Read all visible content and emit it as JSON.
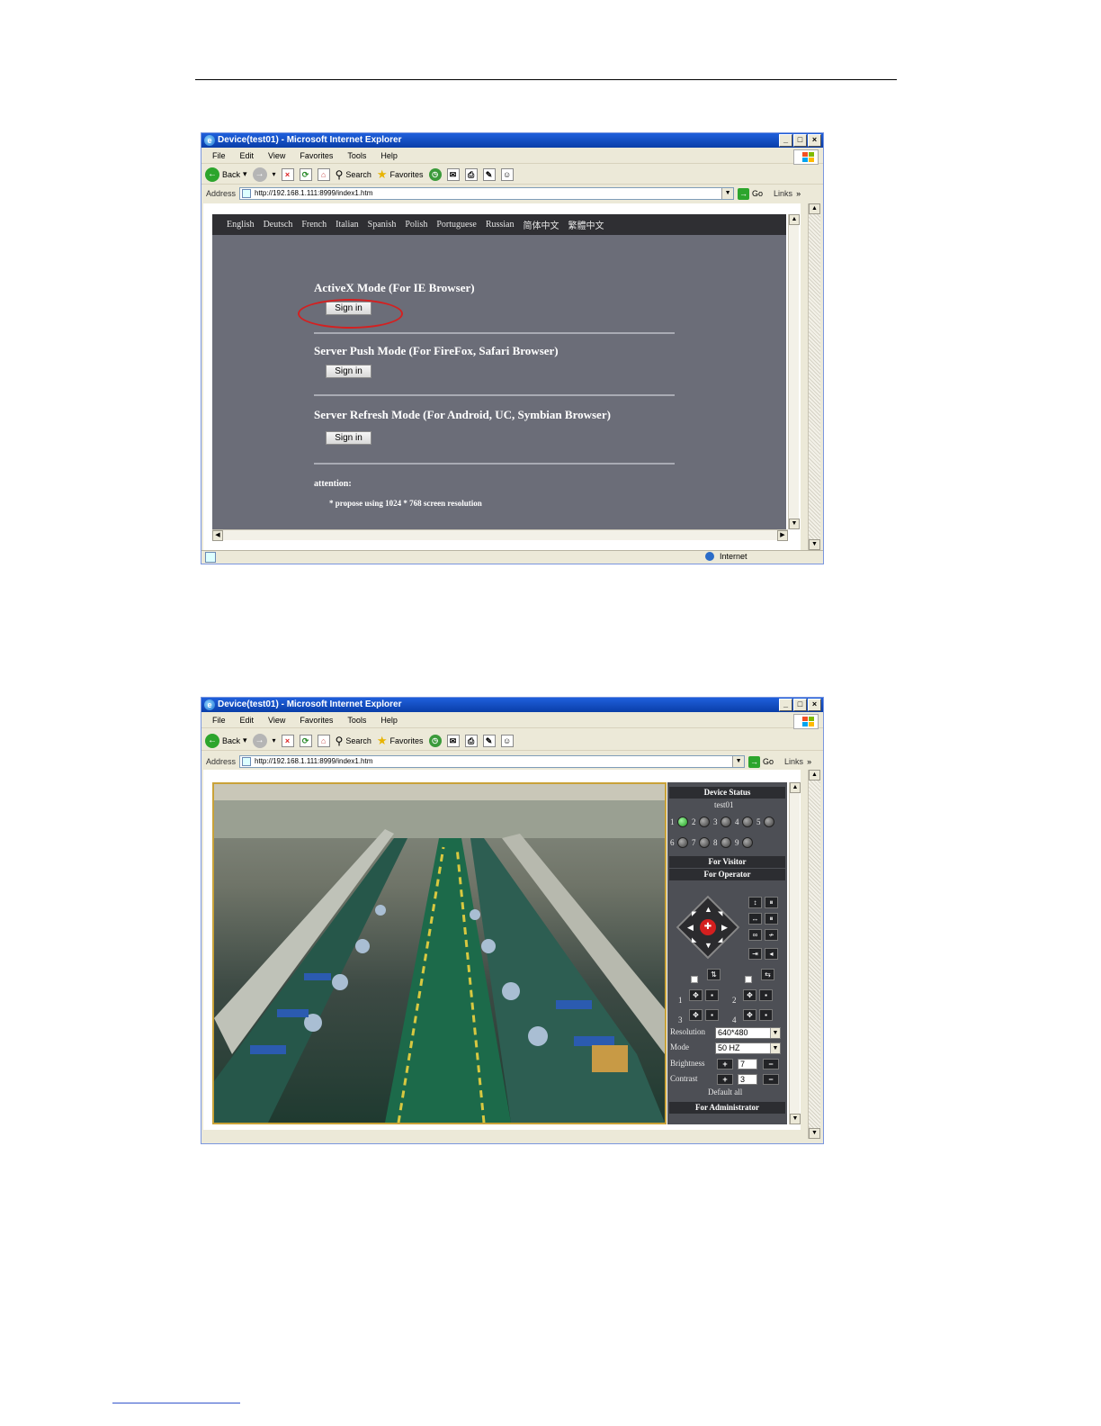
{
  "window1": {
    "title": "Device(test01) - Microsoft Internet Explorer",
    "menu": [
      "File",
      "Edit",
      "View",
      "Favorites",
      "Tools",
      "Help"
    ],
    "toolbar": {
      "back": "Back",
      "search": "Search",
      "favorites": "Favorites"
    },
    "address_label": "Address",
    "address_url": "http://192.168.1.111:8999/index1.htm",
    "go_label": "Go",
    "links_label": "Links",
    "languages": [
      "English",
      "Deutsch",
      "French",
      "Italian",
      "Spanish",
      "Polish",
      "Portuguese",
      "Russian",
      "简体中文",
      "繁體中文"
    ],
    "modes": [
      {
        "title": "ActiveX Mode (For IE Browser)",
        "button": "Sign in"
      },
      {
        "title": "Server Push Mode (For FireFox, Safari Browser)",
        "button": "Sign in"
      },
      {
        "title": "Server Refresh Mode (For Android, UC, Symbian Browser)",
        "button": "Sign in"
      }
    ],
    "attention_label": "attention:",
    "attention_text": "* propose using 1024 * 768 screen resolution",
    "status_zone": "Internet"
  },
  "window2": {
    "title": "Device(test01) - Microsoft Internet Explorer",
    "menu": [
      "File",
      "Edit",
      "View",
      "Favorites",
      "Tools",
      "Help"
    ],
    "toolbar": {
      "back": "Back",
      "search": "Search",
      "favorites": "Favorites"
    },
    "address_label": "Address",
    "address_url": "http://192.168.1.111:8999/index1.htm",
    "go_label": "Go",
    "links_label": "Links",
    "panel": {
      "device_status": "Device Status",
      "device_name": "test01",
      "channels": [
        "1",
        "2",
        "3",
        "4",
        "5",
        "6",
        "7",
        "8",
        "9"
      ],
      "active_channel": "1",
      "for_visitor": "For Visitor",
      "for_operator": "For Operator",
      "presets": [
        "1",
        "2",
        "3",
        "4"
      ],
      "resolution_label": "Resolution",
      "resolution_value": "640*480",
      "mode_label": "Mode",
      "mode_value": "50 HZ",
      "brightness_label": "Brightness",
      "brightness_value": "7",
      "contrast_label": "Contrast",
      "contrast_value": "3",
      "default_all": "Default all",
      "for_administrator": "For Administrator"
    }
  }
}
